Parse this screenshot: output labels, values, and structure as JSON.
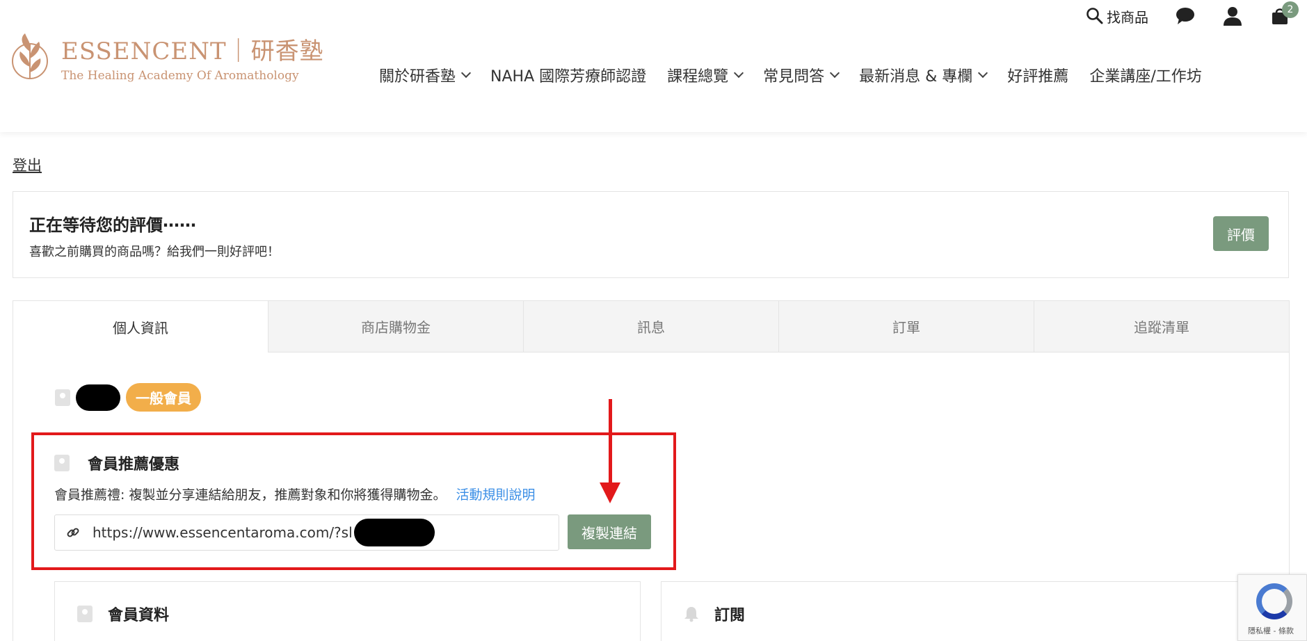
{
  "header": {
    "search_label": "找商品",
    "cart_count": "2",
    "logo": {
      "title": "ESSENCENT｜研香塾",
      "subtitle": "The Healing Academy Of Aromathology"
    },
    "nav": [
      {
        "label": "關於研香塾",
        "dropdown": true
      },
      {
        "label": "NAHA 國際芳療師認證",
        "dropdown": false
      },
      {
        "label": "課程總覽",
        "dropdown": true
      },
      {
        "label": "常見問答",
        "dropdown": true
      },
      {
        "label": "最新消息 & 專欄",
        "dropdown": true
      },
      {
        "label": "好評推薦",
        "dropdown": false
      },
      {
        "label": "企業講座/工作坊",
        "dropdown": false
      }
    ]
  },
  "logout_label": "登出",
  "review": {
    "title": "正在等待您的評價⋯⋯",
    "subtitle": "喜歡之前購買的商品嗎？給我們一則好評吧！",
    "button": "評價"
  },
  "tabs": [
    "個人資訊",
    "商店購物金",
    "訊息",
    "訂單",
    "追蹤清單"
  ],
  "member": {
    "badge": "一般會員"
  },
  "referral": {
    "title": "會員推薦優惠",
    "description": "會員推薦禮: 複製並分享連結給朋友，推薦對象和你將獲得購物金。",
    "rules_link": "活動規則說明",
    "url": "https://www.essencentaroma.com/?sl                 4",
    "copy_button": "複製連結"
  },
  "cards": {
    "member_info": "會員資料",
    "subscription": "訂閱"
  },
  "recaptcha": {
    "text": "隱私權 - 條款"
  },
  "colors": {
    "brand": "#c99372",
    "button_green": "#7a9a7e",
    "badge_orange": "#f2ae4a",
    "highlight_red": "#e2191b",
    "link_blue": "#3a8ee6"
  }
}
